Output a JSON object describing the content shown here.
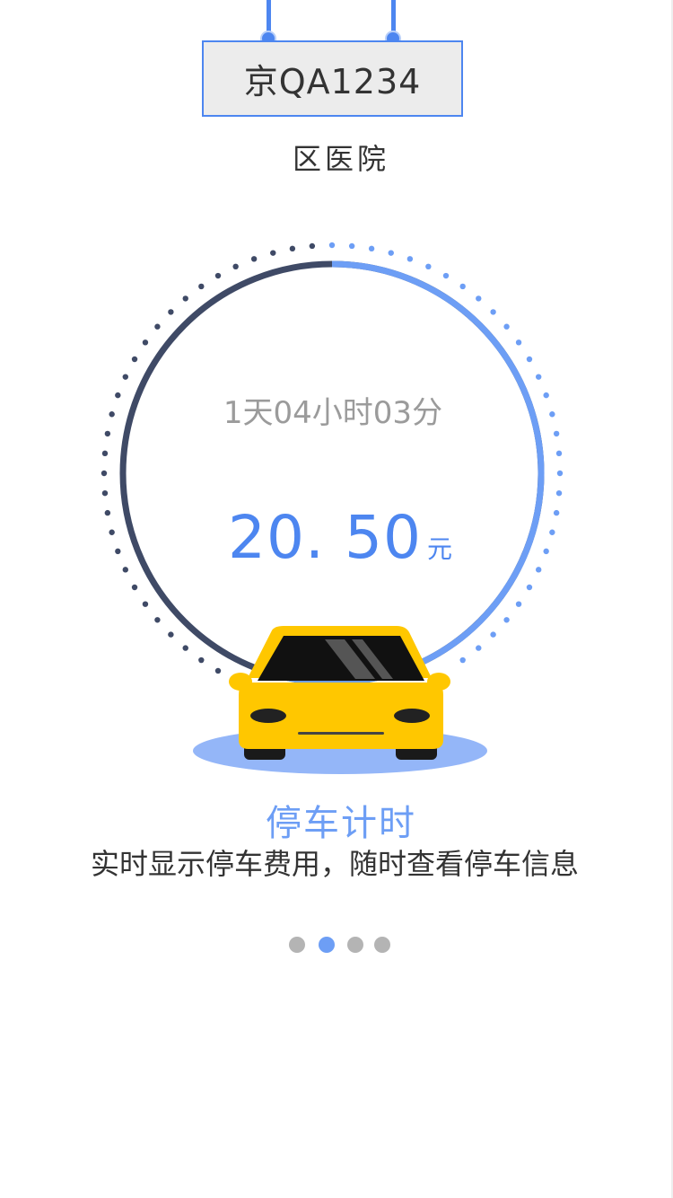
{
  "plate": {
    "number": "京QA1234"
  },
  "location": {
    "name": "区医院"
  },
  "timer": {
    "duration": "1天04小时03分",
    "fee": "20. 50",
    "unit": "元",
    "progress": 0.56
  },
  "feature": {
    "title": "停车计时",
    "description": "实时显示停车费用，随时查看停车信息"
  },
  "pager": {
    "total": 4,
    "active_index": 1
  },
  "colors": {
    "accent": "#4d86f0",
    "accent_light": "#6d9ef5",
    "ring_dark": "#3f4a66",
    "car_yellow": "#ffc700",
    "shadow_blue": "#94b6f8"
  }
}
